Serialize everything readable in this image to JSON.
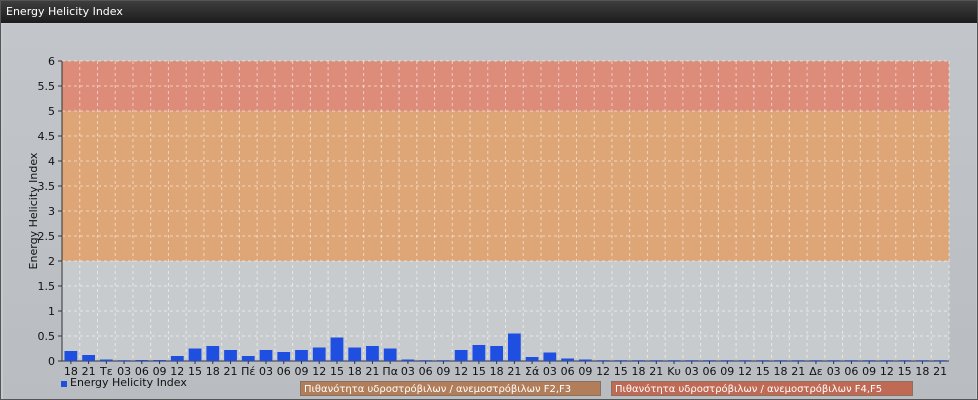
{
  "window": {
    "title": "Energy Helicity Index"
  },
  "chart_data": {
    "type": "bar",
    "title": "",
    "xlabel": "",
    "ylabel": "Energy Helicity Index",
    "ylim": [
      0,
      6
    ],
    "yticks": [
      "0",
      "0.5",
      "1",
      "1.5",
      "2",
      "2.5",
      "3",
      "3.5",
      "4",
      "4.5",
      "5",
      "5.5",
      "6"
    ],
    "grid": true,
    "legend_position": "bottom-left",
    "categories": [
      "18",
      "21",
      "Τε",
      "03",
      "06",
      "09",
      "12",
      "15",
      "18",
      "21",
      "Πέ",
      "03",
      "06",
      "09",
      "12",
      "15",
      "18",
      "21",
      "Πα",
      "03",
      "06",
      "09",
      "12",
      "15",
      "18",
      "21",
      "Σά",
      "03",
      "06",
      "09",
      "12",
      "15",
      "18",
      "21",
      "Κυ",
      "03",
      "06",
      "09",
      "12",
      "15",
      "18",
      "21",
      "Δε",
      "03",
      "06",
      "09",
      "12",
      "15",
      "18",
      "21"
    ],
    "series": [
      {
        "name": "Energy Helicity Index",
        "color": "#1f4fe0",
        "values": [
          0.2,
          0.12,
          0.03,
          0.01,
          0.02,
          0.02,
          0.1,
          0.25,
          0.3,
          0.22,
          0.1,
          0.22,
          0.18,
          0.22,
          0.27,
          0.47,
          0.27,
          0.3,
          0.25,
          0.03,
          0.01,
          0.01,
          0.22,
          0.32,
          0.3,
          0.55,
          0.08,
          0.17,
          0.05,
          0.03,
          0.01,
          0.01,
          0.01,
          0.01,
          0.01,
          0.01,
          0.01,
          0.01,
          0.01,
          0.01,
          0.01,
          0.01,
          0.01,
          0.01,
          0.01,
          0.01,
          0.01,
          0.01,
          0.01,
          0.01
        ]
      }
    ],
    "bands": [
      {
        "from": 2,
        "to": 5,
        "color": "#e0a36f",
        "label": "Πιθανότητα υδροστρόβιλων / ανεμοστρόβιλων F2,F3"
      },
      {
        "from": 5,
        "to": 6,
        "color": "#e08773",
        "label": "Πιθανότητα υδροστρόβιλων / ανεμοστρόβιλων F4,F5"
      }
    ]
  }
}
